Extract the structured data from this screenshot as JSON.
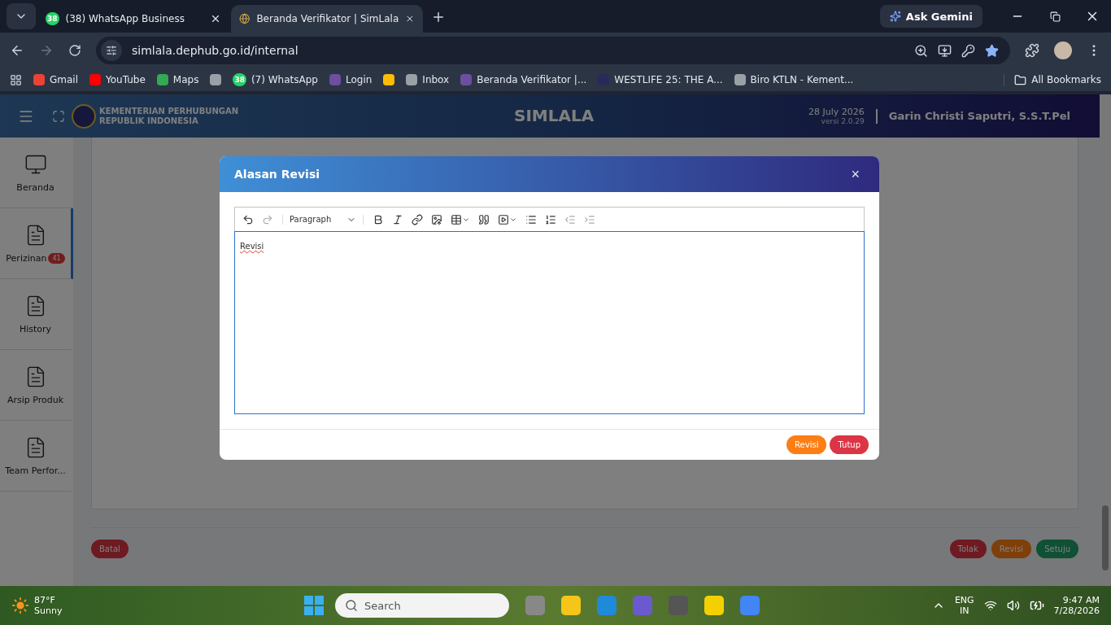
{
  "browser": {
    "tabs": [
      {
        "title": "(38) WhatsApp Business",
        "badge": "38",
        "selected": false
      },
      {
        "title": "Beranda Verifikator | SimLala",
        "selected": true
      }
    ],
    "ask_gemini": "Ask Gemini",
    "address": "simlala.dephub.go.id/internal",
    "bookmarks": [
      {
        "label": "Gmail",
        "color": "#ea4335"
      },
      {
        "label": "YouTube",
        "color": "#ff0000"
      },
      {
        "label": "Maps",
        "color": "#34a853"
      },
      {
        "color": "#9aa0a6"
      },
      {
        "label": "(7) WhatsApp",
        "badge": "38",
        "color": "#25d366"
      },
      {
        "label": "Login",
        "color": "#6b4fa0"
      },
      {
        "color": "#fbbc04"
      },
      {
        "label": "Inbox",
        "color": "#9aa0a6"
      },
      {
        "label": "Beranda Verifikator |...",
        "color": "#6b4fa0"
      },
      {
        "label": "WESTLIFE 25: THE A...",
        "color": "#2a2a5a"
      },
      {
        "label": "Biro KTLN - Kement...",
        "color": "#9aa0a6"
      }
    ],
    "all_bookmarks": "All Bookmarks"
  },
  "header": {
    "org_line_1": "KEMENTERIAN PERHUBUNGAN",
    "org_line_2": "REPUBLIK INDONESIA",
    "title": "SIMLALA",
    "date": "28 July 2026",
    "version": "versi 2.0.29",
    "user": "Garin Christi Saputri, S.S.T.Pel"
  },
  "sidebar": {
    "items": [
      {
        "label": "Beranda",
        "kind": "monitor",
        "selected": false
      },
      {
        "label": "Perizinan",
        "kind": "document",
        "badge": "41",
        "selected": true
      },
      {
        "label": "History",
        "kind": "document",
        "selected": false
      },
      {
        "label": "Arsip Produk",
        "kind": "document",
        "selected": false
      },
      {
        "label": "Team Perfor...",
        "kind": "document",
        "selected": false
      }
    ]
  },
  "page_buttons": [
    {
      "label": "Batal",
      "kind": "danger"
    },
    {
      "label": "Tolak",
      "kind": "danger"
    },
    {
      "label": "Revisi",
      "kind": "warning"
    },
    {
      "label": "Setuju",
      "kind": "success"
    }
  ],
  "modal": {
    "title": "Alasan Revisi",
    "close": "×",
    "block_format": "Paragraph",
    "tools": [
      {
        "kind": "undo",
        "disabled": false
      },
      {
        "kind": "redo",
        "disabled": true
      },
      {
        "kind": "format"
      },
      {
        "kind": "bold",
        "disabled": false
      },
      {
        "kind": "italic",
        "disabled": false
      },
      {
        "kind": "link",
        "disabled": false
      },
      {
        "kind": "image",
        "disabled": false
      },
      {
        "kind": "table",
        "disabled": false
      },
      {
        "kind": "quote",
        "disabled": false
      },
      {
        "kind": "media",
        "disabled": false
      },
      {
        "kind": "bullets",
        "disabled": false
      },
      {
        "kind": "numbers",
        "disabled": false
      },
      {
        "kind": "outdent",
        "disabled": true
      },
      {
        "kind": "indent",
        "disabled": true
      }
    ],
    "content": "Revisi",
    "buttons": [
      {
        "label": "Revisi",
        "kind": "warning"
      },
      {
        "label": "Tutup",
        "kind": "danger"
      }
    ]
  },
  "taskbar": {
    "temperature": "87°F",
    "weather": "Sunny",
    "search_placeholder": "Search",
    "lang": "ENG",
    "region": "IN",
    "time": "9:47 AM",
    "date": "7/28/2026"
  }
}
